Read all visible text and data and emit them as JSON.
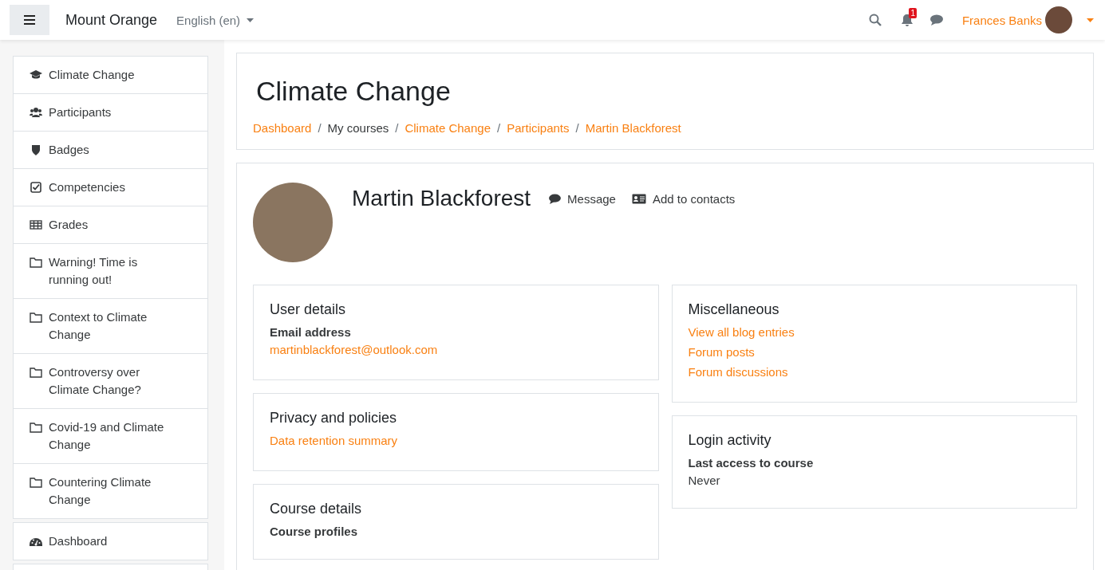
{
  "header": {
    "site_name": "Mount Orange",
    "language": "English (en)",
    "notification_count": "1",
    "user_name": "Frances Banks"
  },
  "sidebar": {
    "groups": [
      [
        {
          "kind": "course",
          "label": "Climate Change"
        },
        {
          "kind": "participants",
          "label": "Participants"
        },
        {
          "kind": "badges",
          "label": "Badges"
        },
        {
          "kind": "competencies",
          "label": "Competencies"
        },
        {
          "kind": "grades",
          "label": "Grades"
        },
        {
          "kind": "section",
          "label": "Warning! Time is running out!"
        },
        {
          "kind": "section",
          "label": "Context to Climate Change"
        },
        {
          "kind": "section",
          "label": "Controversy over Climate Change?"
        },
        {
          "kind": "section",
          "label": "Covid-19 and Climate Change"
        },
        {
          "kind": "section",
          "label": "Countering Climate Change"
        }
      ],
      [
        {
          "kind": "dashboard",
          "label": "Dashboard"
        }
      ]
    ]
  },
  "page_header": {
    "title": "Climate Change",
    "separator": "/",
    "breadcrumbs": [
      {
        "label": "Dashboard",
        "link": true
      },
      {
        "label": "My courses",
        "link": false
      },
      {
        "label": "Climate Change",
        "link": true
      },
      {
        "label": "Participants",
        "link": true
      },
      {
        "label": "Martin Blackforest",
        "link": true
      }
    ]
  },
  "profile": {
    "name": "Martin Blackforest",
    "actions": [
      {
        "kind": "message",
        "label": "Message"
      },
      {
        "kind": "contact",
        "label": "Add to contacts"
      }
    ],
    "columns": [
      [
        {
          "title": "User details",
          "entries": [
            {
              "kind": "label",
              "text": "Email address"
            },
            {
              "kind": "link",
              "text": "martinblackforest@outlook.com"
            }
          ]
        },
        {
          "title": "Privacy and policies",
          "entries": [
            {
              "kind": "link",
              "text": "Data retention summary"
            }
          ]
        },
        {
          "title": "Course details",
          "entries": [
            {
              "kind": "label",
              "text": "Course profiles"
            }
          ]
        }
      ],
      [
        {
          "title": "Miscellaneous",
          "entries": [
            {
              "kind": "link",
              "text": "View all blog entries"
            },
            {
              "kind": "link",
              "text": "Forum posts"
            },
            {
              "kind": "link",
              "text": "Forum discussions"
            }
          ]
        },
        {
          "title": "Login activity",
          "entries": [
            {
              "kind": "label",
              "text": "Last access to course"
            },
            {
              "kind": "text",
              "text": "Never"
            }
          ]
        }
      ]
    ]
  }
}
